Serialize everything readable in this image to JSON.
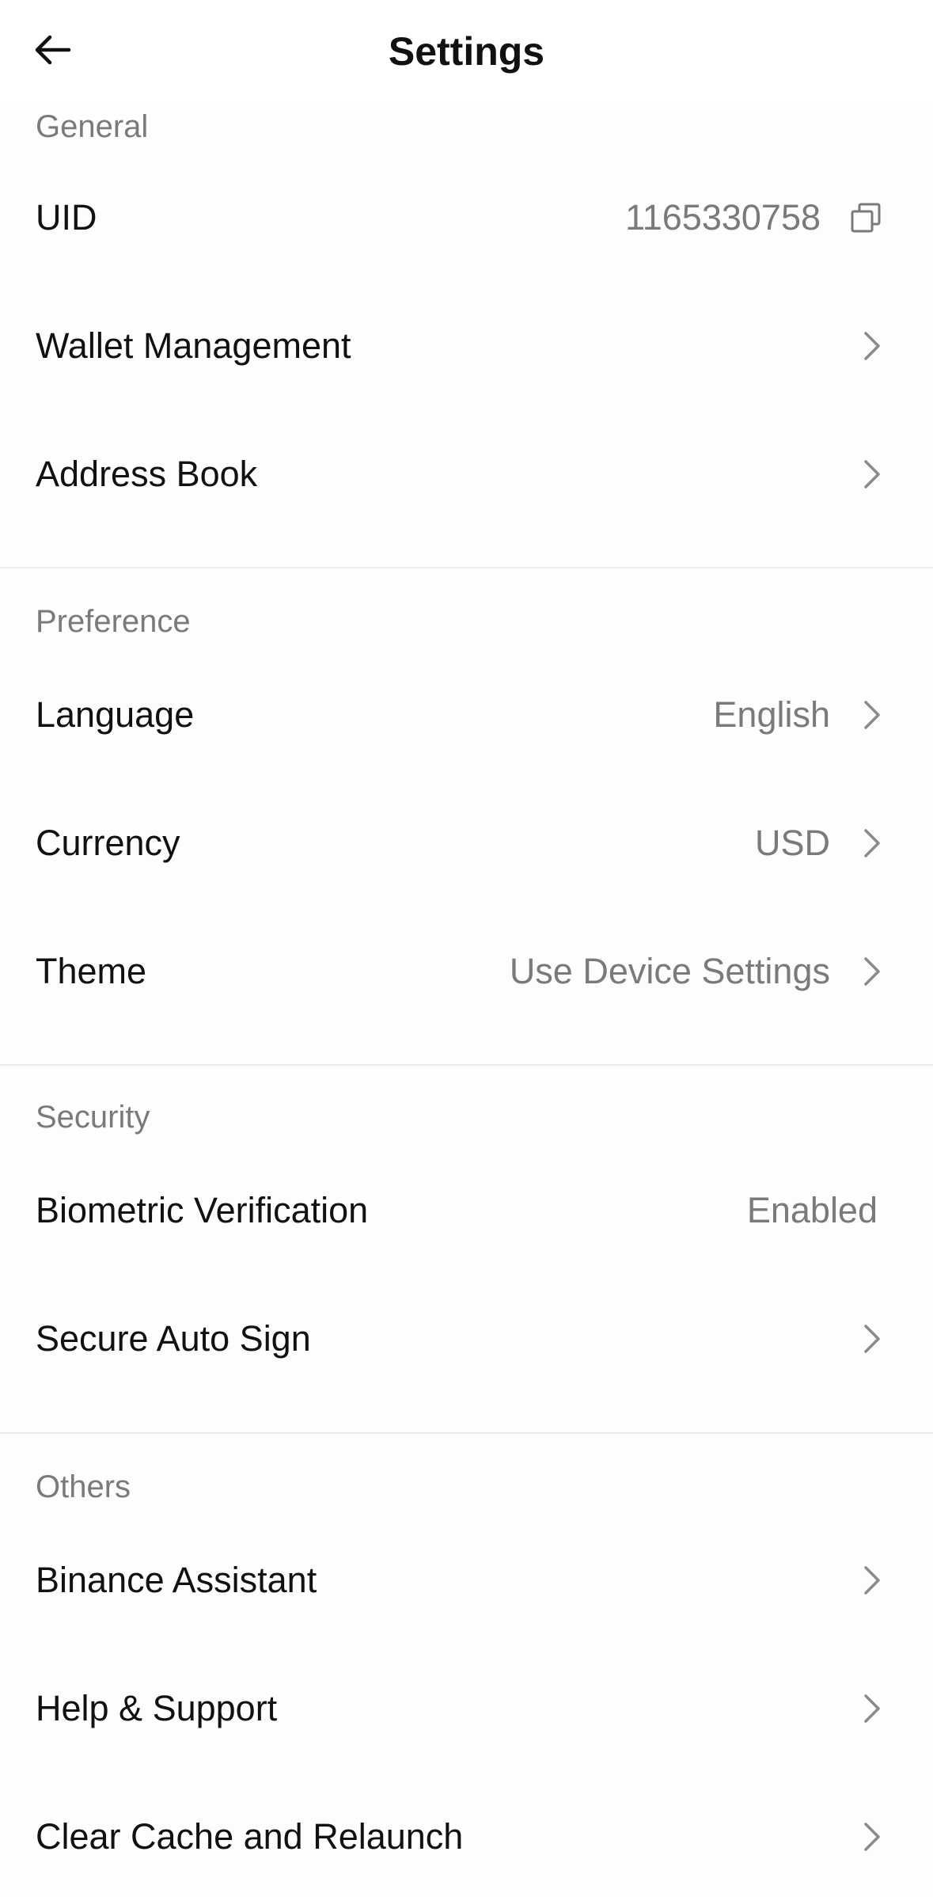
{
  "header": {
    "title": "Settings",
    "back_icon": "arrow-left-icon"
  },
  "sections": {
    "general": {
      "title": "General",
      "uid": {
        "label": "UID",
        "value": "1165330758",
        "icon": "copy-icon"
      },
      "wallet_management": {
        "label": "Wallet Management"
      },
      "address_book": {
        "label": "Address Book"
      }
    },
    "preference": {
      "title": "Preference",
      "language": {
        "label": "Language",
        "value": "English"
      },
      "currency": {
        "label": "Currency",
        "value": "USD"
      },
      "theme": {
        "label": "Theme",
        "value": "Use Device Settings"
      }
    },
    "security": {
      "title": "Security",
      "biometric": {
        "label": "Biometric Verification",
        "value": "Enabled"
      },
      "secure_auto_sign": {
        "label": "Secure Auto Sign"
      }
    },
    "others": {
      "title": "Others",
      "binance_assistant": {
        "label": "Binance Assistant"
      },
      "help_support": {
        "label": "Help & Support"
      },
      "clear_cache": {
        "label": "Clear Cache and Relaunch"
      }
    }
  },
  "colors": {
    "text_primary": "#111111",
    "text_secondary": "#7a7a7a",
    "chevron": "#8a8a8a",
    "divider": "#ececec",
    "background": "#ffffff"
  }
}
